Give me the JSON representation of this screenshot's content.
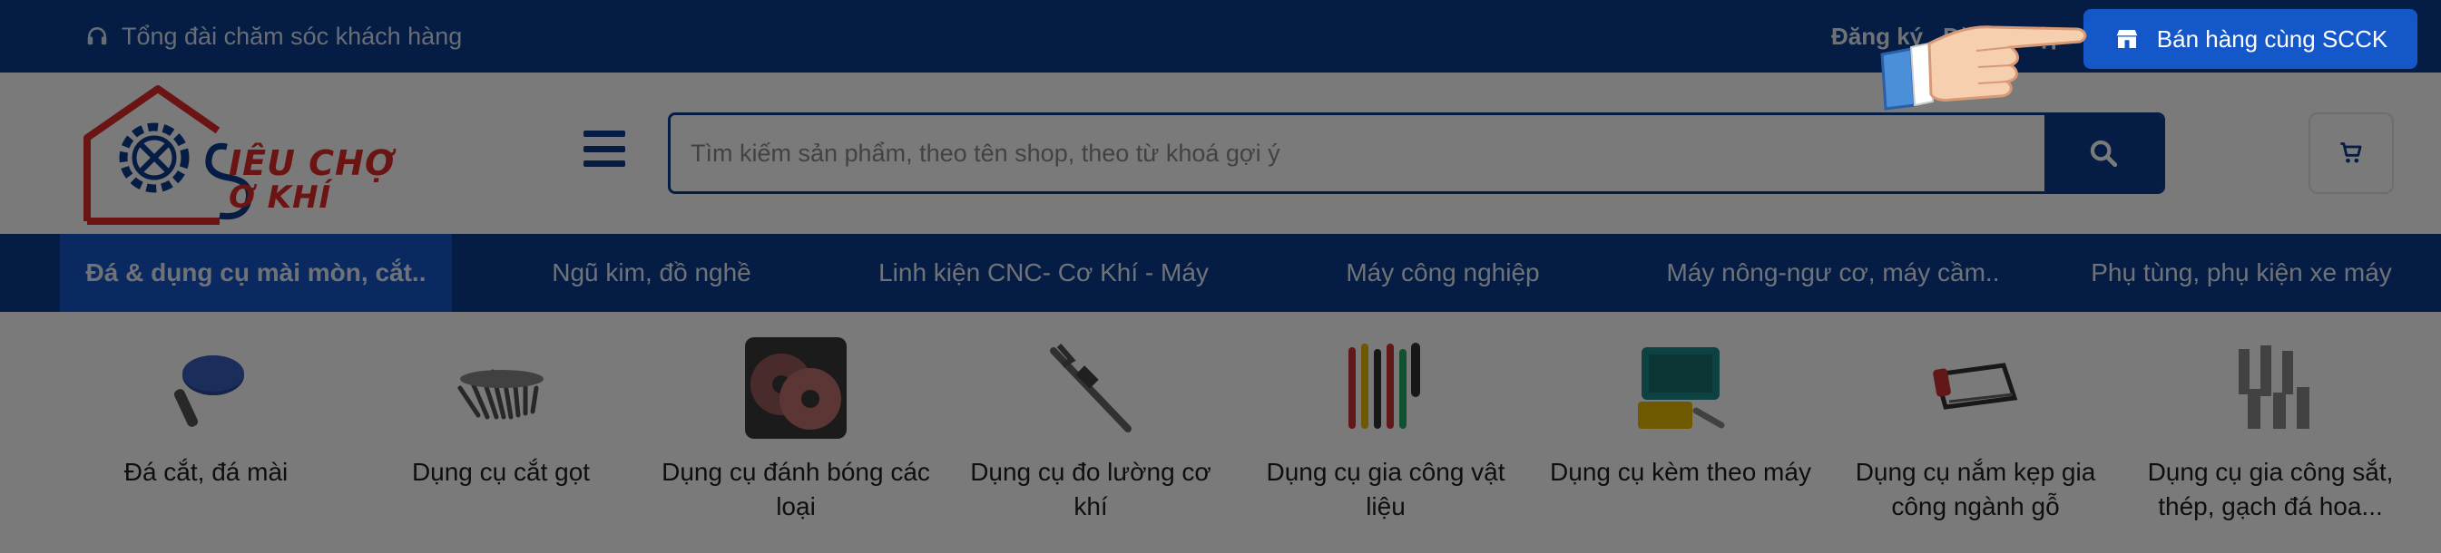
{
  "topbar": {
    "support_label": "Tổng đài chăm sóc khách hàng",
    "register_label": "Đăng ký",
    "login_label": "Đăng nhập",
    "sell_label": "Bán hàng cùng SCCK"
  },
  "header": {
    "logo_line1": "IÊU CHỢ",
    "logo_line2": "Ơ KHÍ",
    "search_placeholder": "Tìm kiếm sản phẩm, theo tên shop, theo từ khoá gợi ý"
  },
  "categories": [
    {
      "label": "Đá & dụng cụ mài mòn, cắt.."
    },
    {
      "label": "Ngũ kim, đồ nghề"
    },
    {
      "label": "Linh kiện CNC- Cơ Khí - Máy"
    },
    {
      "label": "Máy công nghiệp"
    },
    {
      "label": "Máy nông-ngư cơ, máy cầm.."
    },
    {
      "label": "Phụ tùng, phụ kiện xe máy"
    }
  ],
  "subcategories": [
    {
      "label": "Đá cắt, đá mài",
      "icon": "grinding-wheel-icon"
    },
    {
      "label": "Dụng cụ cắt gọt",
      "icon": "cutting-tools-icon"
    },
    {
      "label": "Dụng cụ đánh bóng các loại",
      "icon": "polishing-disc-icon"
    },
    {
      "label": "Dụng cụ đo lường cơ khí",
      "icon": "caliper-icon"
    },
    {
      "label": "Dụng cụ gia công vật liệu",
      "icon": "screwdriver-set-icon"
    },
    {
      "label": "Dụng cụ kèm theo máy",
      "icon": "toolbox-icon"
    },
    {
      "label": "Dụng cụ nắm kẹp gia công ngành gỗ",
      "icon": "hacksaw-icon"
    },
    {
      "label": "Dụng cụ gia công sắt, thép, gạch đá hoa...",
      "icon": "hole-saw-icon"
    }
  ],
  "colors": {
    "primary": "#0b3d91",
    "accent": "#1457c9",
    "logo_red": "#e02a2a"
  }
}
